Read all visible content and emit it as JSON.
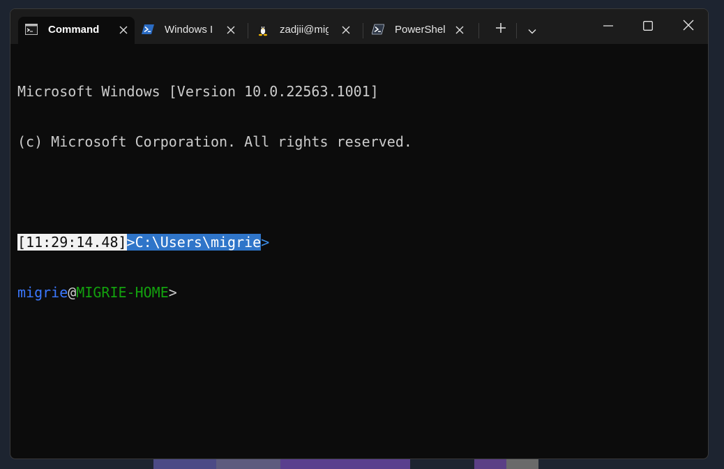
{
  "tabs": [
    {
      "label": "Command",
      "icon": "cmd-icon",
      "active": true
    },
    {
      "label": "Windows I",
      "icon": "powershell-icon",
      "active": false
    },
    {
      "label": "zadjii@mig",
      "icon": "linux-penguin-icon",
      "active": false
    },
    {
      "label": "PowerShel",
      "icon": "powershell-icon",
      "active": false
    }
  ],
  "titlebar_buttons": {
    "new_tab": "plus-icon",
    "dropdown": "chevron-down-icon",
    "minimize": "minimize-icon",
    "maximize": "maximize-icon",
    "close": "close-icon"
  },
  "terminal": {
    "line1": "Microsoft Windows [Version 10.0.22563.1001]",
    "line2": "(c) Microsoft Corporation. All rights reserved.",
    "prompt": {
      "time": "[11:29:14.48]",
      "path": ">C:\\Users\\migrie",
      "arrow": ">"
    },
    "prompt2": {
      "user": "migrie",
      "at": "@",
      "host": "MIGRIE-HOME",
      "gt": ">"
    }
  },
  "colors": {
    "background": "#0c0c0c",
    "titlebar": "#1c1c1c",
    "foreground": "#cccccc",
    "path_highlight": "#2f75c9",
    "user": "#3b78ff",
    "host": "#13a10e"
  }
}
